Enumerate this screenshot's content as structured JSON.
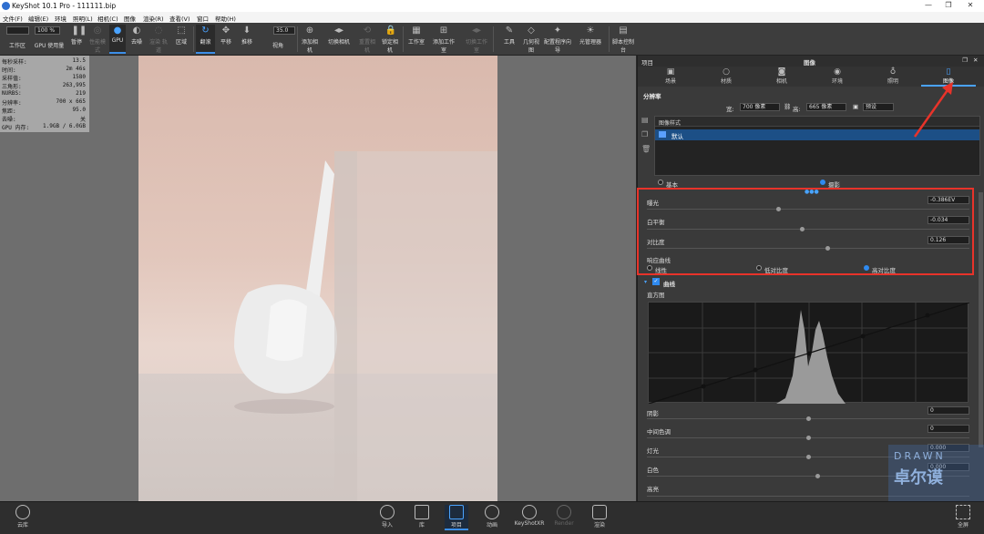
{
  "window": {
    "title": "KeyShot 10.1 Pro  - 111111.bip"
  },
  "menu": [
    "文件(F)",
    "编辑(E)",
    "环境",
    "照明(L)",
    "相机(C)",
    "图像",
    "渲染(R)",
    "查看(V)",
    "窗口",
    "帮助(H)"
  ],
  "toolbar": {
    "workspace_label": "工作区",
    "gpu_label": "GPU 使用量",
    "pause_label": "暂停",
    "perf_label": "性能模式",
    "gpu_btn": "GPU",
    "denoise_label": "去噪",
    "render_label": "渲染 轨道",
    "region_label": "区域",
    "tumble_label": "翻滚",
    "pan_label": "平移",
    "dolly_label": "推移",
    "fov_label": "视角",
    "add_camera": "添加相机",
    "switch_camera": "切换相机",
    "reset_camera": "重置相机",
    "lock_camera": "锁定相机",
    "studio": "工作室",
    "add_studio": "添加工作室",
    "switch_studio": "切换工作室",
    "tools": "工具",
    "geometry": "几何视图",
    "config_wizard": "配置程序向导",
    "light_manager": "光管理器",
    "script_console": "脚本控制台",
    "zoom_value": "100 %",
    "fov_value": "35.0"
  },
  "stats": [
    {
      "label": "每秒采样:",
      "value": "13.5"
    },
    {
      "label": "时间:",
      "value": "2m 46s"
    },
    {
      "label": "采样值:",
      "value": "1580"
    },
    {
      "label": "三角形:",
      "value": "263,995"
    },
    {
      "label": "NURBS:",
      "value": "219"
    },
    {
      "label": "分辨率:",
      "value": "700 x 665"
    },
    {
      "label": "焦距:",
      "value": "95.0"
    },
    {
      "label": "去噪:",
      "value": "关"
    },
    {
      "label": "GPU 内存:",
      "value": "1.9GB / 6.0GB"
    }
  ],
  "panel": {
    "header_left": "项目",
    "header_title": "图像",
    "tabs": [
      "场景",
      "材质",
      "相机",
      "环境",
      "照明",
      "图像"
    ],
    "resolution_title": "分辨率",
    "width_label": "宽:",
    "width_value": "700 像素",
    "height_label": "高:",
    "height_value": "665 像素",
    "preset_label": "预设",
    "styles_header": "图像样式",
    "style_item": "默认",
    "mode_basic": "基本",
    "mode_photo": "摄影",
    "exposure_label": "曝光",
    "exposure_value": "-0.386EV",
    "wb_label": "白平衡",
    "wb_value": "-0.034",
    "contrast_label": "对比度",
    "contrast_value": "0.126",
    "response_label": "响应曲线",
    "curve_linear": "线性",
    "curve_low": "低对比度",
    "curve_high": "高对比度",
    "curves_label": "曲线",
    "histogram_label": "直方图",
    "shadows_label": "阴影",
    "shadows_value": "0",
    "midtones_label": "中间色调",
    "midtones_value": "0",
    "highlights_label": "灯光",
    "highlights_value": "0.000",
    "whites_label": "白色",
    "whites_value": "0.000",
    "high_label": "高亮"
  },
  "bottom": [
    "云库",
    "导入",
    "库",
    "项目",
    "动画",
    "KeyShotXR",
    "渲染",
    "全屏"
  ],
  "bottom_dim": "Render",
  "watermark": {
    "line1": "DRAWN",
    "line2": "卓尔谟"
  }
}
